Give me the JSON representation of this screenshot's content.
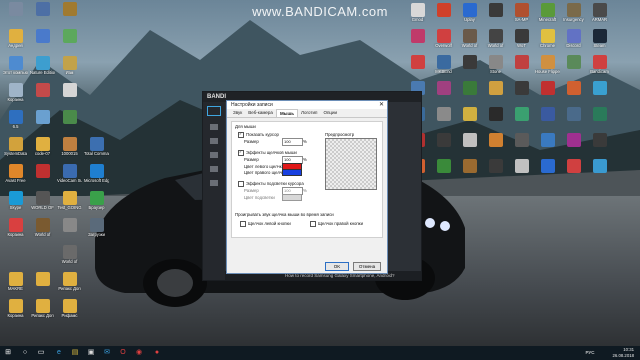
{
  "watermark": "www.BANDICAM.com",
  "desktop_icons": [
    {
      "label": "",
      "x": 0,
      "y": 0,
      "color": "#7a8aa0"
    },
    {
      "label": "",
      "x": 1,
      "y": 0,
      "color": "#4d6fa5"
    },
    {
      "label": "",
      "x": 2,
      "y": 0,
      "color": "#a07a30"
    },
    {
      "label": "Андрей",
      "x": 0,
      "y": 1,
      "color": "#e0b040"
    },
    {
      "label": "",
      "x": 1,
      "y": 1,
      "color": "#4a7acb"
    },
    {
      "label": "",
      "x": 2,
      "y": 1,
      "color": "#5ca85c"
    },
    {
      "label": "Этот компьютер",
      "x": 0,
      "y": 2,
      "color": "#4e8bd0"
    },
    {
      "label": "Nature Edition",
      "x": 1,
      "y": 2,
      "color": "#3d9ecf"
    },
    {
      "label": "Изм",
      "x": 2,
      "y": 2,
      "color": "#c2a24a"
    },
    {
      "label": "Корзина",
      "x": 0,
      "y": 3,
      "color": "#9fb4c8"
    },
    {
      "label": "",
      "x": 1,
      "y": 3,
      "color": "#c44a4a"
    },
    {
      "label": "",
      "x": 2,
      "y": 3,
      "color": "#d5d5d5"
    },
    {
      "label": "6.5",
      "x": 0,
      "y": 4,
      "color": "#2e6fbf"
    },
    {
      "label": "",
      "x": 1,
      "y": 4,
      "color": "#6aa0d0"
    },
    {
      "label": "",
      "x": 2,
      "y": 4,
      "color": "#4a8a4a"
    },
    {
      "label": "SystemData",
      "x": 0,
      "y": 5,
      "color": "#d2a23c"
    },
    {
      "label": "code-07",
      "x": 1,
      "y": 5,
      "color": "#e0b040"
    },
    {
      "label": "1000015",
      "x": 2,
      "y": 5,
      "color": "#c08040"
    },
    {
      "label": "Total Commander",
      "x": 3,
      "y": 5,
      "color": "#3c6fb0"
    },
    {
      "label": "Avast Free",
      "x": 0,
      "y": 6,
      "color": "#e0872a"
    },
    {
      "label": "",
      "x": 1,
      "y": 6,
      "color": "#c03030"
    },
    {
      "label": "VideoCam Suite",
      "x": 2,
      "y": 6,
      "color": "#3a6bb0"
    },
    {
      "label": "Microsoft Edge",
      "x": 3,
      "y": 6,
      "color": "#1f7fd0"
    },
    {
      "label": "Skype",
      "x": 0,
      "y": 7,
      "color": "#1a9ad6"
    },
    {
      "label": "WORLD OF",
      "x": 1,
      "y": 7,
      "color": "#555"
    },
    {
      "label": "Test_GOING",
      "x": 2,
      "y": 7,
      "color": "#e0b040"
    },
    {
      "label": "Браузер",
      "x": 3,
      "y": 7,
      "color": "#3aa04a"
    },
    {
      "label": "Корзина",
      "x": 0,
      "y": 8,
      "color": "#d94040"
    },
    {
      "label": "World of",
      "x": 1,
      "y": 8,
      "color": "#7a5a30"
    },
    {
      "label": "",
      "x": 2,
      "y": 8,
      "color": "#888"
    },
    {
      "label": "Загрузки",
      "x": 3,
      "y": 8,
      "color": "#5a6a7a"
    },
    {
      "label": "World of",
      "x": 2,
      "y": 9,
      "color": "#6a6a6a"
    },
    {
      "label": "MAKRE",
      "x": 0,
      "y": 10,
      "color": "#e0b040"
    },
    {
      "label": "",
      "x": 1,
      "y": 10,
      "color": "#e0b040"
    },
    {
      "label": "Рипакс Доп",
      "x": 2,
      "y": 10,
      "color": "#e0b040"
    },
    {
      "label": "Корзина",
      "x": 0,
      "y": 11,
      "color": "#e0b040"
    },
    {
      "label": "Рипакс Доп",
      "x": 1,
      "y": 11,
      "color": "#e0b040"
    },
    {
      "label": "Рифамс",
      "x": 2,
      "y": 11,
      "color": "#e0b040"
    }
  ],
  "right_icons": [
    {
      "label": "Gmod",
      "color": "#d8d8d8"
    },
    {
      "label": "",
      "color": "#d0402a"
    },
    {
      "label": "Uplay",
      "color": "#2a6ad0"
    },
    {
      "label": "",
      "color": "#3a3a3a"
    },
    {
      "label": "SA-MP",
      "color": "#b05030"
    },
    {
      "label": "Minecraft",
      "color": "#5a9a3a"
    },
    {
      "label": "Insurgency",
      "color": "#7a6a4a"
    },
    {
      "label": "ARMAR",
      "color": "#4a4a4a"
    },
    {
      "label": "",
      "color": "#c03a6a"
    },
    {
      "label": "Overwolf",
      "color": "#d04040"
    },
    {
      "label": "World of",
      "color": "#6a5a4a"
    },
    {
      "label": "World of",
      "color": "#444"
    },
    {
      "label": "WoT",
      "color": "#3a3a3a"
    },
    {
      "label": "Chrome",
      "color": "#e0c040"
    },
    {
      "label": "Discord",
      "color": "#6272c4"
    },
    {
      "label": "Steam",
      "color": "#1b2838"
    },
    {
      "label": "",
      "color": "#d04040"
    },
    {
      "label": "MKBEnd",
      "color": "#3a6aa0"
    },
    {
      "label": "",
      "color": "#3a3a3a"
    },
    {
      "label": "Stone",
      "color": "#888"
    },
    {
      "label": "",
      "color": "#c04040"
    },
    {
      "label": "House Flipper",
      "color": "#d09040"
    },
    {
      "label": "",
      "color": "#5a8a5a"
    },
    {
      "label": "Bandicam",
      "color": "#d04040"
    },
    {
      "label": "",
      "color": "#4a7ab0"
    },
    {
      "label": "",
      "color": "#a04080"
    },
    {
      "label": "",
      "color": "#3a7a3a"
    },
    {
      "label": "",
      "color": "#d0a040"
    },
    {
      "label": "",
      "color": "#3a3a3a"
    },
    {
      "label": "",
      "color": "#c03030"
    },
    {
      "label": "",
      "color": "#d06030"
    },
    {
      "label": "",
      "color": "#3aa0d0"
    },
    {
      "label": "",
      "color": "#3a6a9a"
    },
    {
      "label": "",
      "color": "#8a8a8a"
    },
    {
      "label": "",
      "color": "#d0b040"
    },
    {
      "label": "",
      "color": "#2a2a2a"
    },
    {
      "label": "",
      "color": "#3aa070"
    },
    {
      "label": "",
      "color": "#3a5aa0"
    },
    {
      "label": "",
      "color": "#4a6a8a"
    },
    {
      "label": "",
      "color": "#2a7a5a"
    },
    {
      "label": "",
      "color": "#b03030"
    },
    {
      "label": "",
      "color": "#3a3a3a"
    },
    {
      "label": "",
      "color": "#c0c0c0"
    },
    {
      "label": "",
      "color": "#d08030"
    },
    {
      "label": "",
      "color": "#5a5a5a"
    },
    {
      "label": "",
      "color": "#3a7ac0"
    },
    {
      "label": "",
      "color": "#a03090"
    },
    {
      "label": "",
      "color": "#3a3a3a"
    },
    {
      "label": "",
      "color": "#d06030"
    },
    {
      "label": "",
      "color": "#3a8a3a"
    },
    {
      "label": "",
      "color": "#9a6a30"
    },
    {
      "label": "",
      "color": "#3a3a3a"
    },
    {
      "label": "",
      "color": "#c0c0c0"
    },
    {
      "label": "",
      "color": "#2a6ad0"
    },
    {
      "label": "",
      "color": "#d04040"
    },
    {
      "label": "",
      "color": "#3a9ad0"
    }
  ],
  "bandicam": {
    "title": "BANDI",
    "bottom_text": "How to record Samsung Galaxy Smartphone, Android?"
  },
  "dialog": {
    "title": "Настройки записи",
    "close": "✕",
    "tabs": [
      "Звук",
      "Веб-камера",
      "Мышь",
      "Логотип",
      "Опции"
    ],
    "active_tab": "Мышь",
    "group_mouse": "Для мыши",
    "show_cursor": "Показать курсор",
    "size_label": "Размер",
    "size_value": "100",
    "percent": "%",
    "click_effects": "Эффекты щелчков мыши",
    "click_size_label": "Размер",
    "click_size_value": "100",
    "left_click_color": "Цвет левого щелчка",
    "right_click_color": "Цвет правого щелчка",
    "highlight_effects": "Эффекты подсветки курсора",
    "highlight_size_label": "Размер",
    "highlight_size_value": "100",
    "highlight_color": "Цвет подсветки",
    "preview_label": "Предпросмотр",
    "sound_group": "Проигрывать звук щелчка мыши во время записи",
    "left_click_sound": "Щелчок левой кнопки",
    "right_click_sound": "Щелчок правой кнопки",
    "ok": "OK",
    "cancel": "Отмена",
    "left_color": "#e01818",
    "right_color": "#1840e0"
  },
  "taskbar": {
    "time": "10:31",
    "date": "26.08.2018",
    "lang": "РУС"
  }
}
